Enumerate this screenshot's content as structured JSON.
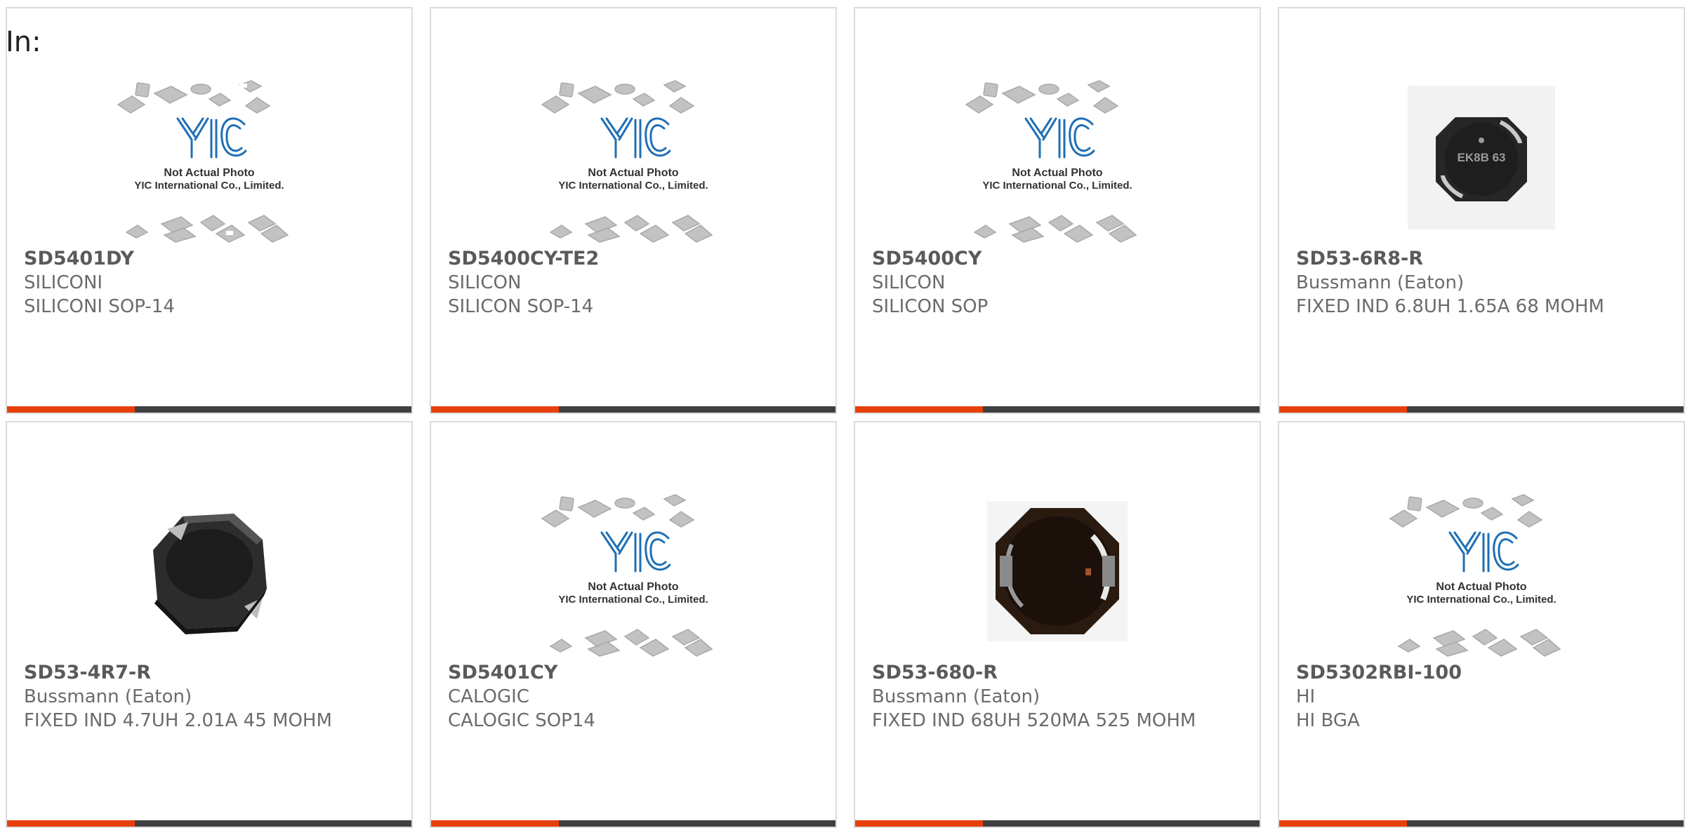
{
  "page": {
    "label": "In:"
  },
  "colors": {
    "accent": "#e8400c",
    "bar": "#3f3f3f",
    "card_border": "#dcdcdc",
    "text": "#6b6b6b"
  },
  "placeholder": {
    "logo": "YIC",
    "line1": "Not Actual Photo",
    "line2": "YIC International Co., Limited."
  },
  "cards": [
    {
      "part": "SD5401DY",
      "maker": "SILICONI",
      "desc": "SILICONI SOP-14",
      "image": "placeholder"
    },
    {
      "part": "SD5400CY-TE2",
      "maker": "SILICON",
      "desc": "SILICON SOP-14",
      "image": "placeholder"
    },
    {
      "part": "SD5400CY",
      "maker": "SILICON",
      "desc": "SILICON SOP",
      "image": "placeholder"
    },
    {
      "part": "SD53-6R8-R",
      "maker": "Bussmann (Eaton)",
      "desc": "FIXED IND 6.8UH 1.65A 68 MOHM",
      "image": "inductor-top",
      "marking": "EK8B 63"
    },
    {
      "part": "SD53-4R7-R",
      "maker": "Bussmann (Eaton)",
      "desc": "FIXED IND 4.7UH 2.01A 45 MOHM",
      "image": "inductor-angled"
    },
    {
      "part": "SD5401CY",
      "maker": "CALOGIC",
      "desc": "CALOGIC SOP14",
      "image": "placeholder"
    },
    {
      "part": "SD53-680-R",
      "maker": "Bussmann (Eaton)",
      "desc": "FIXED IND 68UH 520MA 525 MOHM",
      "image": "inductor-dark"
    },
    {
      "part": "SD5302RBI-100",
      "maker": "HI",
      "desc": "HI BGA",
      "image": "placeholder"
    }
  ]
}
